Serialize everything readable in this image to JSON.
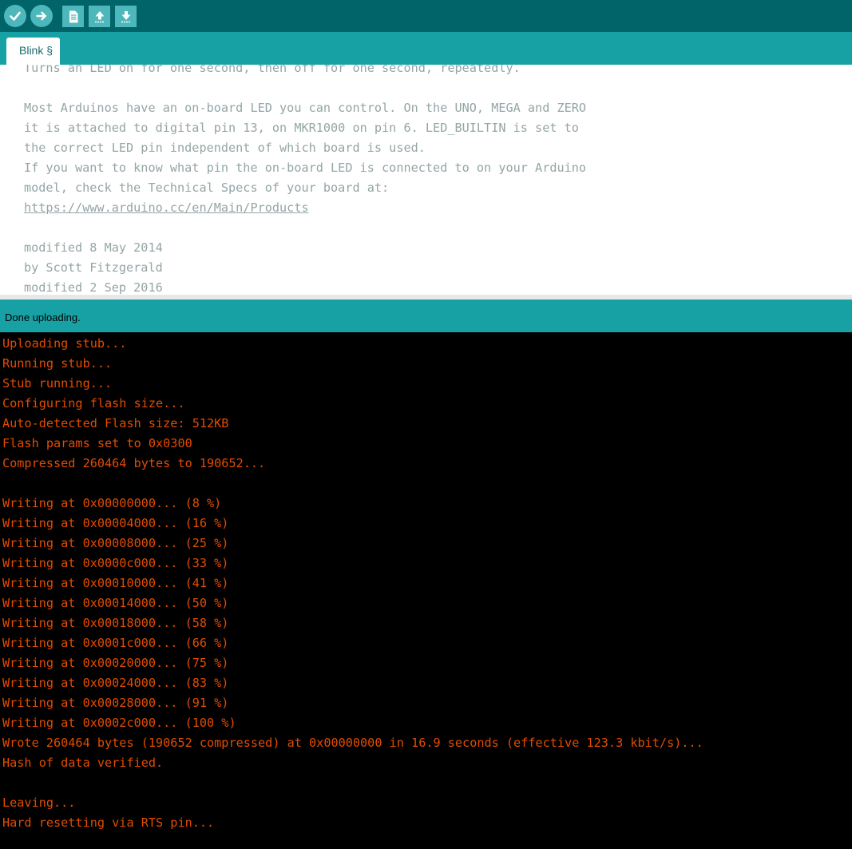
{
  "toolbar": {
    "buttons": [
      {
        "name": "verify",
        "icon": "checkmark-icon"
      },
      {
        "name": "upload",
        "icon": "arrow-right-icon"
      },
      {
        "name": "new",
        "icon": "document-icon"
      },
      {
        "name": "open",
        "icon": "arrow-up-icon"
      },
      {
        "name": "save",
        "icon": "arrow-down-icon"
      }
    ]
  },
  "tabs": [
    {
      "label": "Blink §",
      "active": true
    }
  ],
  "editor": {
    "lines": [
      "Turns an LED on for one second, then off for one second, repeatedly.",
      "",
      "Most Arduinos have an on-board LED you can control. On the UNO, MEGA and ZERO",
      "it is attached to digital pin 13, on MKR1000 on pin 6. LED_BUILTIN is set to",
      "the correct LED pin independent of which board is used.",
      "If you want to know what pin the on-board LED is connected to on your Arduino",
      "model, check the Technical Specs of your board at:",
      "https://www.arduino.cc/en/Main/Products",
      "",
      "modified 8 May 2014",
      "by Scott Fitzgerald",
      "modified 2 Sep 2016"
    ],
    "link": "https://www.arduino.cc/en/Main/Products"
  },
  "status": {
    "message": "Done uploading."
  },
  "console": {
    "lines": [
      "Uploading stub...",
      "Running stub...",
      "Stub running...",
      "Configuring flash size...",
      "Auto-detected Flash size: 512KB",
      "Flash params set to 0x0300",
      "Compressed 260464 bytes to 190652...",
      "",
      "Writing at 0x00000000... (8 %)",
      "Writing at 0x00004000... (16 %)",
      "Writing at 0x00008000... (25 %)",
      "Writing at 0x0000c000... (33 %)",
      "Writing at 0x00010000... (41 %)",
      "Writing at 0x00014000... (50 %)",
      "Writing at 0x00018000... (58 %)",
      "Writing at 0x0001c000... (66 %)",
      "Writing at 0x00020000... (75 %)",
      "Writing at 0x00024000... (83 %)",
      "Writing at 0x00028000... (91 %)",
      "Writing at 0x0002c000... (100 %)",
      "Wrote 260464 bytes (190652 compressed) at 0x00000000 in 16.9 seconds (effective 123.3 kbit/s)...",
      "Hash of data verified.",
      "",
      "Leaving...",
      "Hard resetting via RTS pin..."
    ]
  },
  "colors": {
    "toolbar_bg": "#006468",
    "accent": "#17a1a5",
    "button_bg": "#4db7bb",
    "comment_text": "#95a5a6",
    "console_text": "#e34c00",
    "console_bg": "#000000"
  }
}
